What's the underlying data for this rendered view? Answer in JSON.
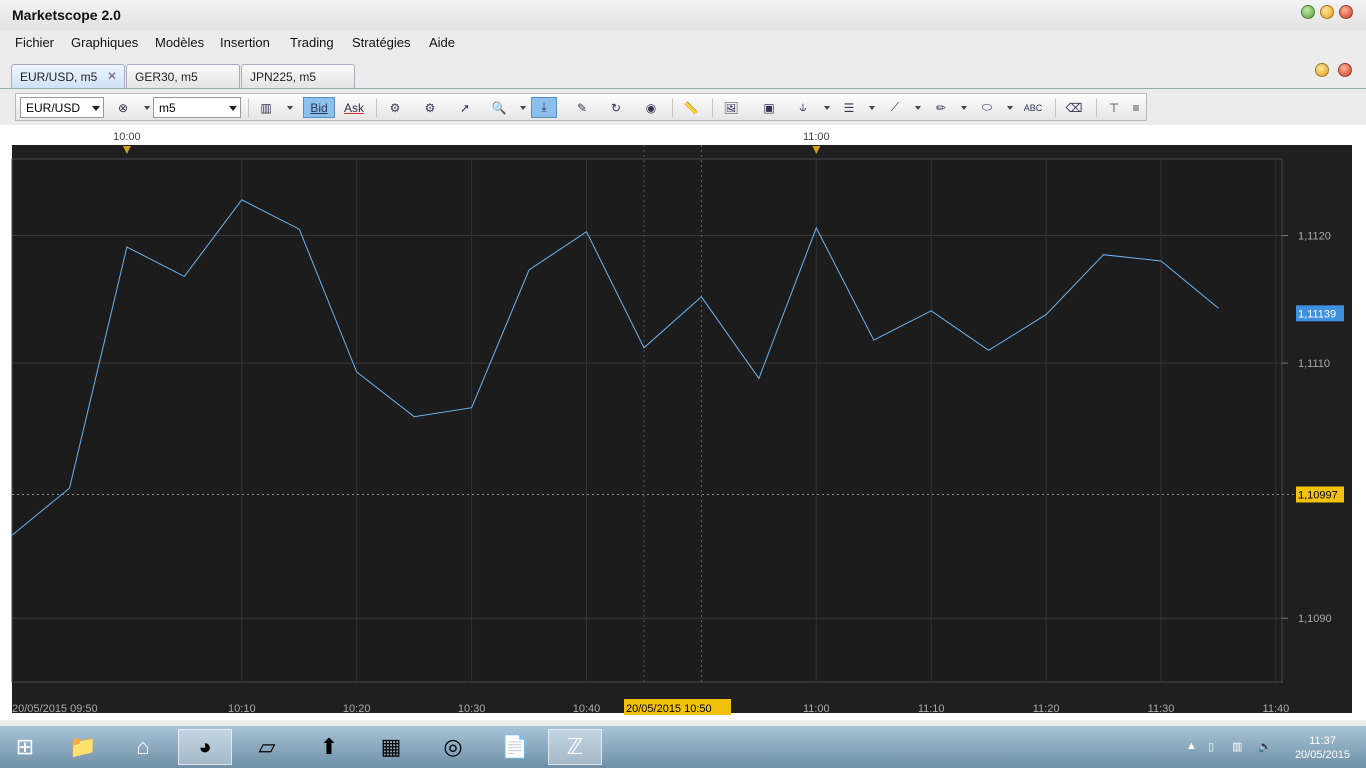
{
  "app": {
    "title": "Marketscope 2.0"
  },
  "menu": [
    "Fichier",
    "Graphiques",
    "Modèles",
    "Insertion",
    "Trading",
    "Stratégies",
    "Aide"
  ],
  "tabs": [
    {
      "label": "EUR/USD, m5",
      "active": true
    },
    {
      "label": "GER30, m5",
      "active": false
    },
    {
      "label": "JPN225, m5",
      "active": false
    }
  ],
  "toolbar": {
    "instrument": "EUR/USD",
    "timeframe": "m5",
    "bid_label": "Bid",
    "ask_label": "Ask"
  },
  "chart_data": {
    "type": "line",
    "instrument": "EUR/USD",
    "timeframe": "m5",
    "x": [
      "09:50",
      "09:55",
      "10:00",
      "10:05",
      "10:10",
      "10:15",
      "10:20",
      "10:25",
      "10:30",
      "10:35",
      "10:40",
      "10:45",
      "10:50",
      "10:55",
      "11:00",
      "11:05",
      "11:10",
      "11:15",
      "11:20",
      "11:25",
      "11:30",
      "11:35"
    ],
    "values": [
      1.10965,
      1.11002,
      1.11191,
      1.11168,
      1.11228,
      1.11205,
      1.11093,
      1.11058,
      1.11065,
      1.11173,
      1.11203,
      1.11112,
      1.11152,
      1.11088,
      1.11206,
      1.11118,
      1.11141,
      1.1111,
      1.11138,
      1.11185,
      1.1118,
      1.11143
    ],
    "ylim": [
      1.1085,
      1.1126
    ],
    "y_ticks": [
      "1,1090",
      "1,1110",
      "1,1120"
    ],
    "x_ticks_bottom": [
      "10:10",
      "10:20",
      "10:30",
      "10:40",
      "11:00",
      "11:10",
      "11:20",
      "11:30",
      "11:40"
    ],
    "x_ticks_top": [
      "10:00",
      "11:00"
    ],
    "start_label": "20/05/2015 09:50",
    "cursor_time_label": "20/05/2015 10:50",
    "last_price_label": "1,11139",
    "crosshair_price_label": "1,10997",
    "line_color": "#6ab4f2",
    "last_price_color": "#3d8fe0",
    "crosshair_color": "#f2c10c",
    "grid": true
  },
  "taskbar": {
    "time": "11:37",
    "date": "20/05/2015"
  }
}
